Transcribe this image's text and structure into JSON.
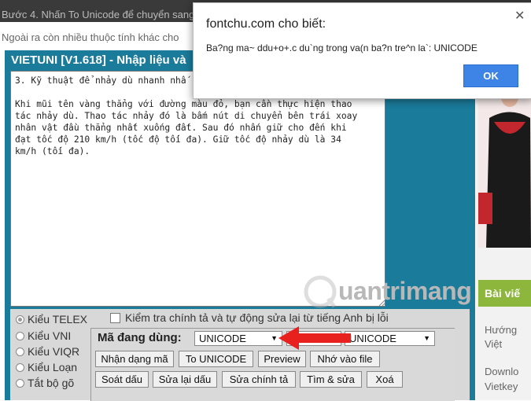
{
  "background": {
    "line1": "Bước 4. Nhấn To Unicode để chuyển sang",
    "line2": "Ngoài ra còn nhiều thuộc tính khác cho",
    "right_header": "Bài viế",
    "right_links": [
      "Hướng",
      "Việt",
      "Downlo",
      "Vietkey"
    ]
  },
  "vietuni": {
    "title": "VIETUNI [V1.618] - Nhập liệu và",
    "editor_text": "3. Kỹ thuật để nhảy dù nhanh nhấ\n\nKhi mũi tên vàng thẳng với đường màu đỏ, bạn cần thực hiện thao\ntác nhảy dù. Thao tác nhảy đó là bấm nút di chuyển bên trái xoay\nnhân vật đầu thẳng nhất xuống đất. Sau đó nhấn giữ cho đến khi\nđạt tốc độ 210 km/h (tốc độ tối đa). Giữ tốc độ nhảy dù là 34\nkm/h (tối đa).",
    "typing_modes": [
      {
        "label": "Kiểu TELEX",
        "selected": true
      },
      {
        "label": "Kiểu VNI",
        "selected": false
      },
      {
        "label": "Kiểu VIQR",
        "selected": false
      },
      {
        "label": "Kiểu Loạn",
        "selected": false
      },
      {
        "label": "Tắt bộ gõ",
        "selected": false
      }
    ],
    "spell_check_label": "Kiểm tra chính tả và tự động sửa lại từ tiếng Anh bị lỗi",
    "encoding_label": "Mã đang dùng:",
    "encoding_from": "UNICODE",
    "encoding_to": "UNICODE",
    "buttons_row1": [
      "Nhận dạng mã",
      "To UNICODE",
      "Preview",
      "Nhớ vào file"
    ],
    "buttons_row2": [
      "Soát dấu",
      "Sửa lại dấu",
      "Sửa chính tả",
      "Tìm & sửa",
      "Xoá"
    ]
  },
  "watermark": "uantrimang",
  "dialog": {
    "title": "fontchu.com cho biết:",
    "message": "Ba?ng ma~ ddu+o+.c du`ng trong va(n ba?n tre^n la`: UNICODE",
    "ok_label": "OK",
    "close_icon": "close-icon"
  },
  "colors": {
    "panel": "#1b7b9b",
    "ok_button": "#3d84e6",
    "arrow": "#e8201e",
    "green_bar": "#8db63c"
  }
}
